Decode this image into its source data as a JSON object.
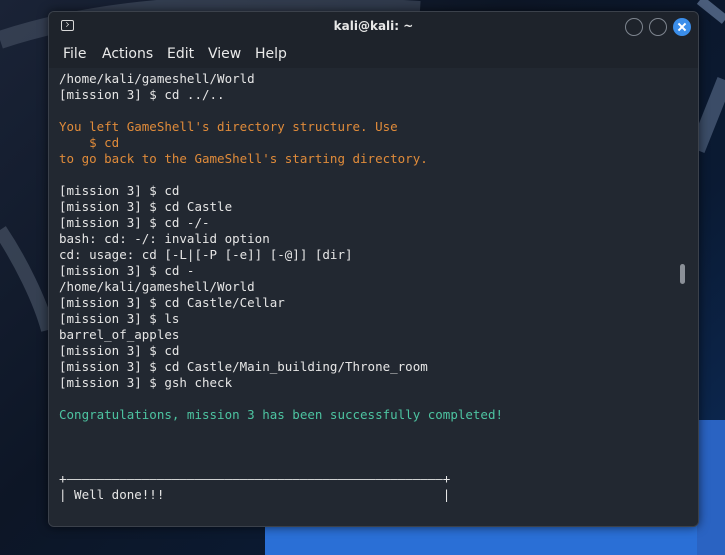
{
  "window": {
    "title": "kali@kali: ~"
  },
  "menu": {
    "items": [
      "File",
      "Actions",
      "Edit",
      "View",
      "Help"
    ]
  },
  "terminal": {
    "lines": [
      {
        "text": "/home/kali/gameshell/World",
        "style": "white"
      },
      {
        "text": "[mission 3] $ cd ../..",
        "style": "white"
      },
      {
        "text": "",
        "style": "white"
      },
      {
        "text": "You left GameShell's directory structure. Use",
        "style": "orange"
      },
      {
        "text": "    $ cd",
        "style": "orange"
      },
      {
        "text": "to go back to the GameShell's starting directory.",
        "style": "orange"
      },
      {
        "text": "",
        "style": "white"
      },
      {
        "text": "[mission 3] $ cd",
        "style": "white"
      },
      {
        "text": "[mission 3] $ cd Castle",
        "style": "white"
      },
      {
        "text": "[mission 3] $ cd -/-",
        "style": "white"
      },
      {
        "text": "bash: cd: -/: invalid option",
        "style": "white"
      },
      {
        "text": "cd: usage: cd [-L|[-P [-e]] [-@]] [dir]",
        "style": "white"
      },
      {
        "text": "[mission 3] $ cd -",
        "style": "white"
      },
      {
        "text": "/home/kali/gameshell/World",
        "style": "white"
      },
      {
        "text": "[mission 3] $ cd Castle/Cellar",
        "style": "white"
      },
      {
        "text": "[mission 3] $ ls",
        "style": "white"
      },
      {
        "text": "barrel_of_apples",
        "style": "white"
      },
      {
        "text": "[mission 3] $ cd",
        "style": "white"
      },
      {
        "text": "[mission 3] $ cd Castle/Main_building/Throne_room",
        "style": "white"
      },
      {
        "text": "[mission 3] $ gsh check",
        "style": "white"
      },
      {
        "text": "",
        "style": "white"
      },
      {
        "text": "Congratulations, mission 3 has been successfully completed!",
        "style": "green"
      },
      {
        "text": "",
        "style": "white"
      },
      {
        "text": "",
        "style": "white"
      },
      {
        "text": "",
        "style": "white"
      },
      {
        "text": "+——————————————————————————————————————————————————+",
        "style": "white"
      },
      {
        "text": "| Well done!!!                                     |",
        "style": "white"
      }
    ]
  },
  "colors": {
    "terminal_bg": "#222831",
    "titlebar_bg": "#1e232b",
    "text": "#e6e6e6",
    "warning": "#e08b3a",
    "success": "#4dc4a1",
    "close_button": "#3b8eea"
  },
  "icons": {
    "window_icon": "terminal-icon",
    "minimize": "minimize-icon",
    "maximize": "maximize-icon",
    "close": "close-icon"
  }
}
